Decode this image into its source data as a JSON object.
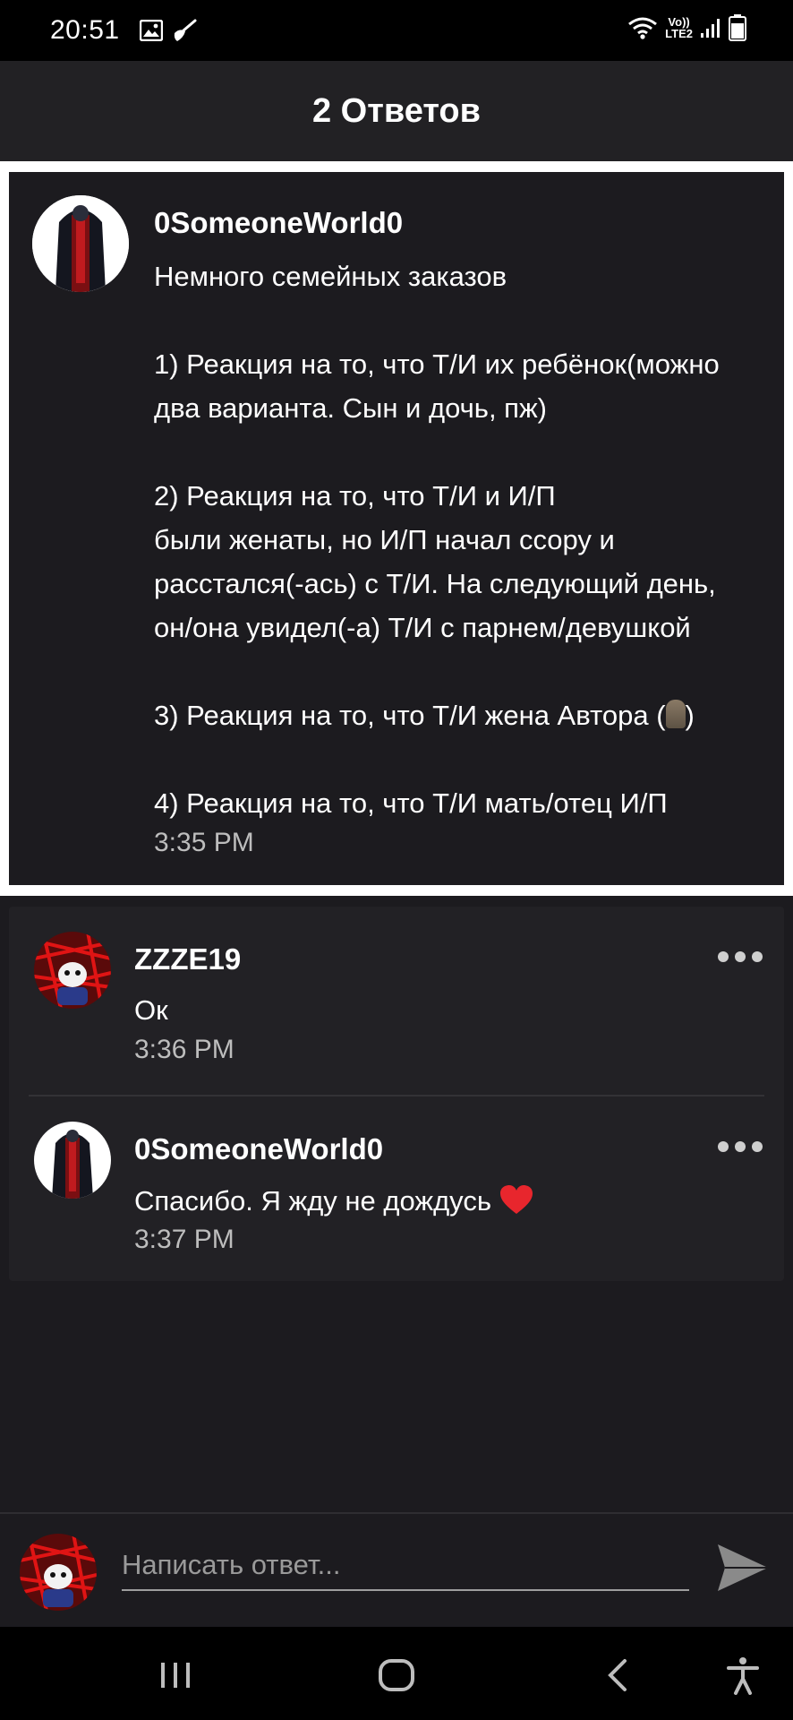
{
  "status_bar": {
    "time": "20:51",
    "network_top": "Vo))",
    "network_bottom": "LTE2",
    "icons": [
      "image-icon",
      "broom-icon",
      "wifi-icon",
      "signal-icon",
      "battery-icon"
    ]
  },
  "header": {
    "title": "2 Ответов"
  },
  "post": {
    "author": "0SomeoneWorld0",
    "lines": [
      "Немного семейных заказов",
      "",
      "1) Реакция на то, что Т/И их ребёнок(можно",
      "два варианта. Сын и дочь, пж)",
      "",
      "2) Реакция на то, что Т/И и И/П",
      "были женаты, но И/П начал ссору и",
      "расстался(-ась) с Т/И. На следующий день,",
      "он/она увидел(-а) Т/И с парнем/девушкой",
      "",
      "3) Реакция на то, что Т/И жена Автора (",
      "",
      "4) Реакция на то, что Т/И мать/отец И/П"
    ],
    "line3_suffix": ")",
    "time": "3:35 PM"
  },
  "replies": [
    {
      "author": "ZZZE19",
      "text": "Ок",
      "time": "3:36 PM"
    },
    {
      "author": "0SomeoneWorld0",
      "text": "Спасибо. Я жду не дождусь",
      "time": "3:37 PM"
    }
  ],
  "input": {
    "placeholder": "Написать ответ..."
  },
  "colors": {
    "background": "#1c1b1f",
    "header": "#222124",
    "heart": "#e8262d"
  }
}
